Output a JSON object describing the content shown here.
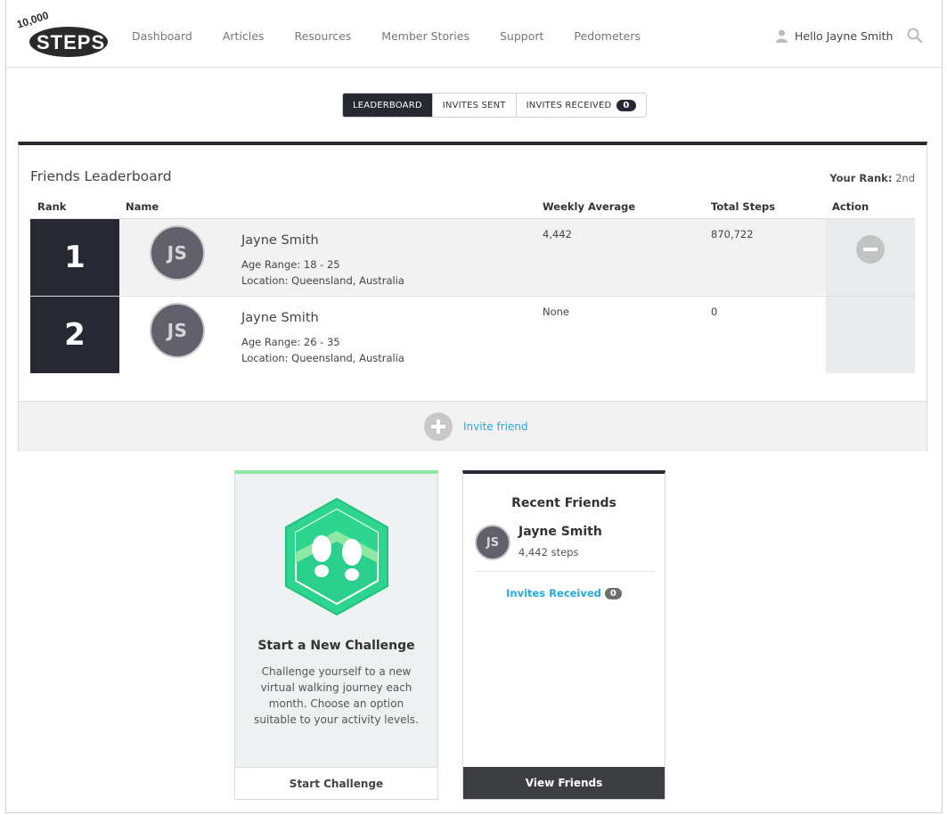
{
  "brand": {
    "logo_top": "10,000",
    "logo_main": "STEPS"
  },
  "nav": [
    "Dashboard",
    "Articles",
    "Resources",
    "Member Stories",
    "Support",
    "Pedometers"
  ],
  "user": {
    "greeting": "Hello Jayne Smith"
  },
  "tabs": {
    "leaderboard": "LEADERBOARD",
    "invites_sent": "INVITES SENT",
    "invites_received": "INVITES RECEIVED",
    "invites_received_count": "0"
  },
  "leaderboard": {
    "title": "Friends Leaderboard",
    "your_rank_label": "Your Rank:",
    "your_rank_value": "2nd",
    "columns": {
      "rank": "Rank",
      "name": "Name",
      "weekly": "Weekly Average",
      "total": "Total Steps",
      "action": "Action"
    },
    "rows": [
      {
        "rank": "1",
        "initials": "JS",
        "name": "Jayne Smith",
        "age": "Age Range: 18 - 25",
        "location": "Location: Queensland, Australia",
        "weekly": "4,442",
        "total": "870,722"
      },
      {
        "rank": "2",
        "initials": "JS",
        "name": "Jayne Smith",
        "age": "Age Range: 26 - 35",
        "location": "Location: Queensland, Australia",
        "weekly": "None",
        "total": "0"
      }
    ],
    "invite_label": "Invite friend"
  },
  "challenge": {
    "title": "Start a New Challenge",
    "description": "Challenge yourself to a new virtual walking journey each month. Choose an option suitable to your activity levels.",
    "button": "Start Challenge"
  },
  "recent_friends": {
    "title": "Recent Friends",
    "friend": {
      "initials": "JS",
      "name": "Jayne Smith",
      "steps": "4,442 steps"
    },
    "invites_label": "Invites Received",
    "invites_count": "0",
    "button": "View Friends"
  },
  "colors": {
    "dark": "#262932",
    "accent_link": "#25a9df",
    "challenge_green": "#2ed58f",
    "challenge_top": "#8ee8a4"
  }
}
